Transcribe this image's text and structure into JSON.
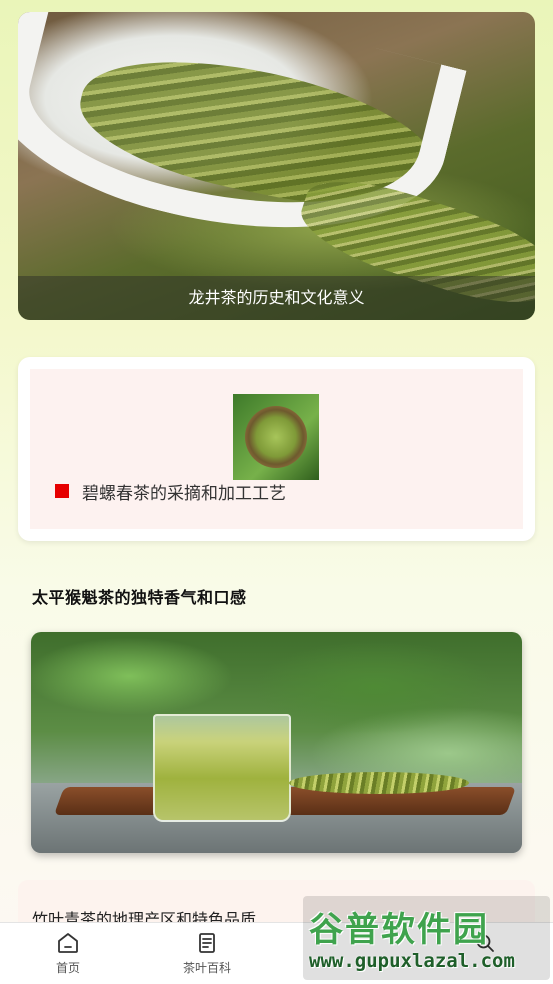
{
  "hero": {
    "caption": "龙井茶的历史和文化意义"
  },
  "card2": {
    "title": "碧螺春茶的采摘和加工工艺",
    "bullet_color": "#e60000"
  },
  "section": {
    "title": "太平猴魁茶的独特香气和口感"
  },
  "card4": {
    "title": "竹叶青茶的地理产区和特色品质"
  },
  "bottom_nav": {
    "items": [
      {
        "label": "首页",
        "icon": "home-icon"
      },
      {
        "label": "茶叶百科",
        "icon": "book-icon"
      },
      {
        "label": "",
        "icon": "search-icon"
      }
    ]
  },
  "watermark": {
    "line1": "谷普软件园",
    "line2": "www.gupuxlazal.com"
  }
}
